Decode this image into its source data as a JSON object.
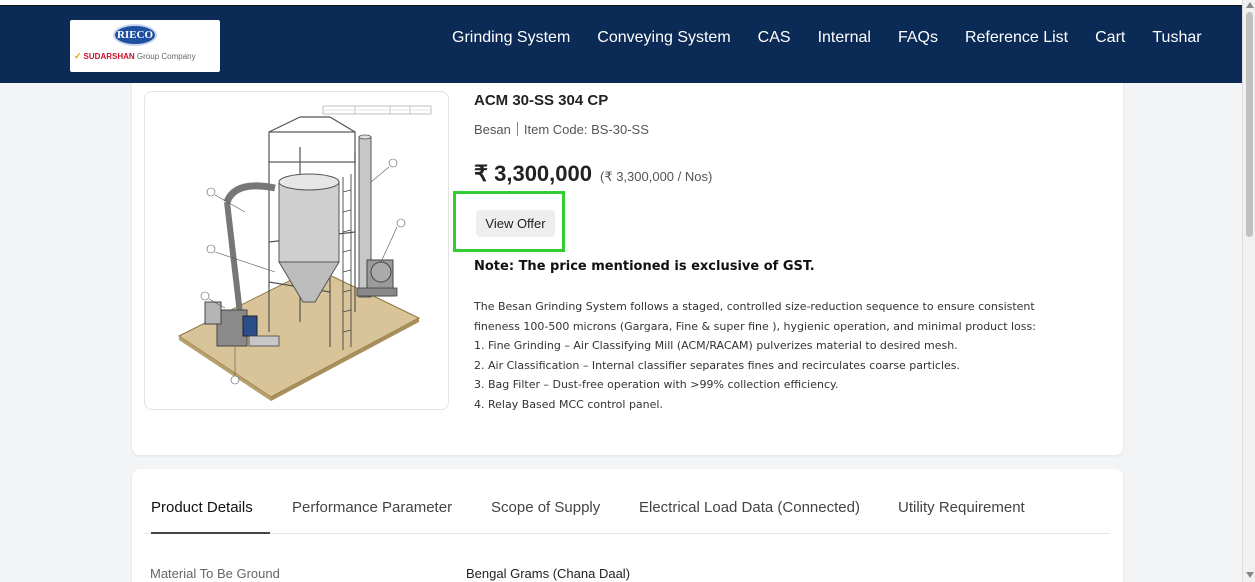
{
  "colors": {
    "navbar": "#0b2a55",
    "highlight": "#32cd32",
    "brand_red": "#c8102e"
  },
  "logo": {
    "mark": "RIECO",
    "brand": "SUDARSHAN",
    "sub": "Group Company"
  },
  "nav": {
    "items": [
      "Grinding System",
      "Conveying System",
      "CAS",
      "Internal",
      "FAQs",
      "Reference List",
      "Cart",
      "Tushar"
    ]
  },
  "product": {
    "title": "ACM 30-SS 304 CP",
    "category": "Besan",
    "item_code": "Item Code: BS-30-SS",
    "price": "₹ 3,300,000",
    "unit_price": "(₹ 3,300,000 / Nos)",
    "offer_button": "View Offer",
    "note": "Note: The price mentioned is exclusive of GST.",
    "description": [
      "The Besan Grinding System follows a staged, controlled size-reduction sequence to ensure consistent",
      "fineness 100-500 microns (Gargara, Fine & super fine ), hygienic operation, and minimal product loss:",
      "1. Fine Grinding – Air Classifying Mill (ACM/RACAM) pulverizes material to desired mesh.",
      "2. Air Classification – Internal classifier separates fines and recirculates coarse particles.",
      "3. Bag Filter – Dust-free operation with >99% collection efficiency.",
      "4. Relay Based MCC control panel."
    ]
  },
  "tabs": [
    "Product Details",
    "Performance Parameter",
    "Scope of Supply",
    "Electrical Load Data (Connected)",
    "Utility Requirement"
  ],
  "details": {
    "rows": [
      {
        "label": "Material To Be Ground",
        "value": "Bengal Grams (Chana Daal)"
      }
    ]
  },
  "icons": {
    "scroll_up": "scroll-up-icon",
    "scroll_down": "scroll-down-icon"
  }
}
